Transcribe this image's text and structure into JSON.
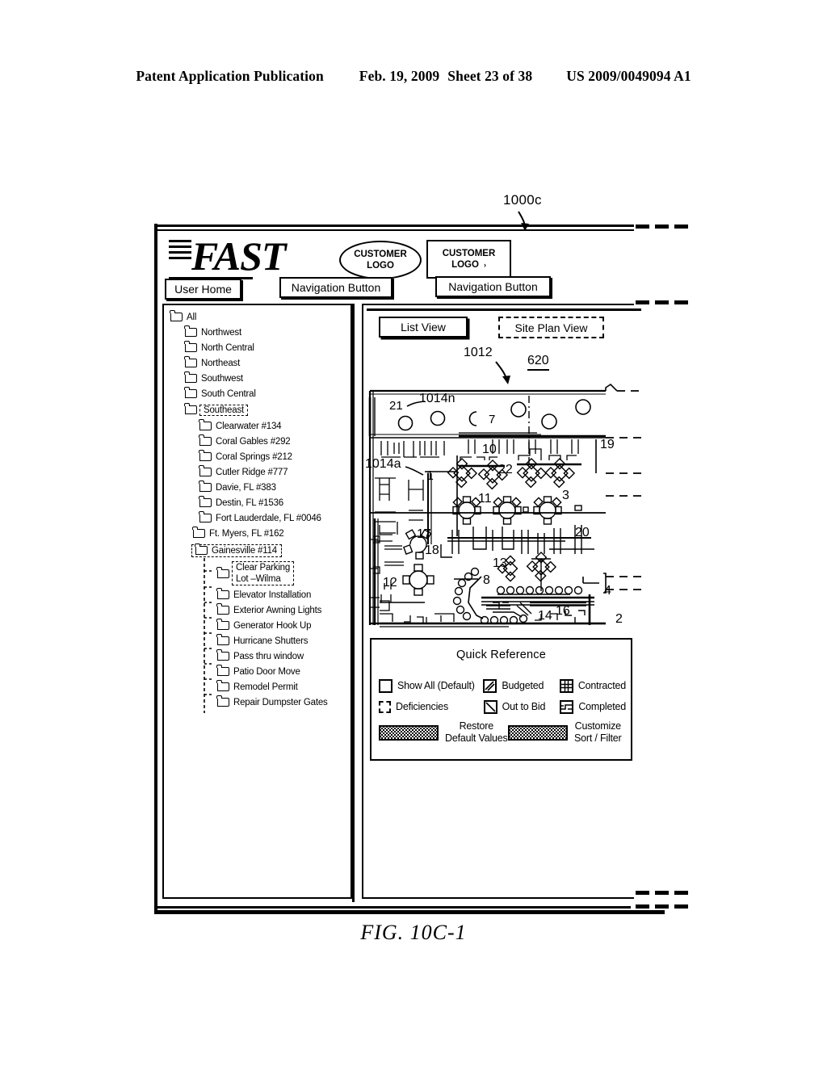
{
  "patent_header": {
    "publication": "Patent Application Publication",
    "date": "Feb. 19, 2009",
    "sheet": "Sheet 23 of 38",
    "number": "US 2009/0049094 A1"
  },
  "figure": {
    "caption": "FIG. 10C-1",
    "screen_ref": "1000c"
  },
  "app": {
    "brand": "FAST",
    "logo_oval_line1": "CUSTOMER",
    "logo_oval_line2": "LOGO",
    "logo_rect_line1": "CUSTOMER",
    "logo_rect_line2": "LOGO",
    "logo_rect_tick": "›",
    "nav": {
      "user_home": "User Home",
      "button_1": "Navigation Button",
      "button_2": "Navigation Button"
    }
  },
  "sidebar": {
    "root": {
      "label": "All",
      "indent": 0,
      "selected": false
    },
    "regions": [
      {
        "label": "Northwest",
        "indent": 1,
        "selected": false
      },
      {
        "label": "North Central",
        "indent": 1,
        "selected": false
      },
      {
        "label": "Northeast",
        "indent": 1,
        "selected": false
      },
      {
        "label": "Southwest",
        "indent": 1,
        "selected": false
      },
      {
        "label": "South Central",
        "indent": 1,
        "selected": false
      },
      {
        "label": "Southeast",
        "indent": 1,
        "selected": true
      }
    ],
    "sites": [
      {
        "label": "Clearwater #134",
        "selected": false
      },
      {
        "label": "Coral Gables #292",
        "selected": false
      },
      {
        "label": "Coral Springs #212",
        "selected": false
      },
      {
        "label": "Cutler Ridge #777",
        "selected": false
      },
      {
        "label": "Davie, FL #383",
        "selected": false
      },
      {
        "label": "Destin, FL #1536",
        "selected": false
      },
      {
        "label": "Fort Lauderdale, FL #0046",
        "selected": false
      },
      {
        "label": "Ft. Myers, FL #162",
        "selected": false
      },
      {
        "label": "Gainesville #114",
        "selected": true
      }
    ],
    "projects": [
      {
        "label": "Clear Parking\nLot –Wilma",
        "line1": "Clear Parking",
        "line2": "Lot –Wilma",
        "selected": true,
        "two_line": true
      },
      {
        "label": "Elevator Installation",
        "selected": false,
        "two_line": false
      },
      {
        "label": "Exterior Awning Lights",
        "selected": false,
        "two_line": false
      },
      {
        "label": "Generator Hook Up",
        "selected": false,
        "two_line": false
      },
      {
        "label": "Hurricane Shutters",
        "selected": false,
        "two_line": false
      },
      {
        "label": "Pass thru window",
        "selected": false,
        "two_line": false
      },
      {
        "label": "Patio Door Move",
        "selected": false,
        "two_line": false
      },
      {
        "label": "Remodel Permit",
        "selected": false,
        "two_line": false
      },
      {
        "label": "Repair Dumpster Gates",
        "selected": false,
        "two_line": false
      }
    ]
  },
  "main": {
    "tabs": [
      {
        "label": "List View",
        "selected": false
      },
      {
        "label": "Site Plan View",
        "selected": true
      }
    ],
    "refs": {
      "plan_ref": "1012",
      "plan_id": "620",
      "area_ref_a": "1014a",
      "area_ref_n": "1014n"
    },
    "site_plan_callouts": [
      "21",
      "7",
      "10",
      "19",
      "1",
      "22",
      "3",
      "11",
      "17",
      "20",
      "13",
      "8",
      "4",
      "12",
      "18",
      "16",
      "14",
      "2"
    ]
  },
  "quick_reference": {
    "title": "Quick Reference",
    "legend": [
      {
        "label": "Show All (Default)",
        "icon": "empty-square-icon"
      },
      {
        "label": "Budgeted",
        "icon": "double-hatch-icon"
      },
      {
        "label": "Contracted",
        "icon": "grid-square-icon"
      },
      {
        "label": "Deficiencies",
        "icon": "dashed-corners-icon"
      },
      {
        "label": "Out to Bid",
        "icon": "backslash-hatch-icon"
      },
      {
        "label": "Completed",
        "icon": "zigzag-square-icon"
      }
    ],
    "buttons": [
      {
        "line1": "Restore",
        "line2": "Default Values",
        "icon": "stipple-button-icon"
      },
      {
        "line1": "Customize",
        "line2": "Sort / Filter",
        "icon": "stipple-button-icon"
      }
    ]
  }
}
